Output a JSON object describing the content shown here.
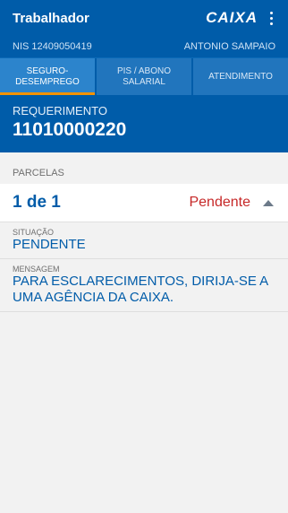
{
  "app": {
    "title": "Trabalhador",
    "logo_text": "CAIXA"
  },
  "user": {
    "nis": "NIS 12409050419",
    "name": "ANTONIO SAMPAIO"
  },
  "tabs": [
    {
      "line1": "SEGURO-",
      "line2": "DESEMPREGO",
      "active": true
    },
    {
      "line1": "PIS / ABONO",
      "line2": "SALARIAL",
      "active": false
    },
    {
      "line1": "ATENDIMENTO",
      "line2": "",
      "active": false
    }
  ],
  "requerimento": {
    "label": "REQUERIMENTO",
    "value": "11010000220"
  },
  "parcelas": {
    "label": "PARCELAS",
    "count": "1 de 1",
    "status": "Pendente"
  },
  "situacao": {
    "label": "SITUAÇÃO",
    "value": "PENDENTE"
  },
  "mensagem": {
    "label": "MENSAGEM",
    "value": "PARA ESCLARECIMENTOS, DIRIJA-SE A UMA AGÊNCIA DA CAIXA."
  },
  "colors": {
    "primary": "#005ca9",
    "accent": "#f39200",
    "pending": "#c62828"
  }
}
